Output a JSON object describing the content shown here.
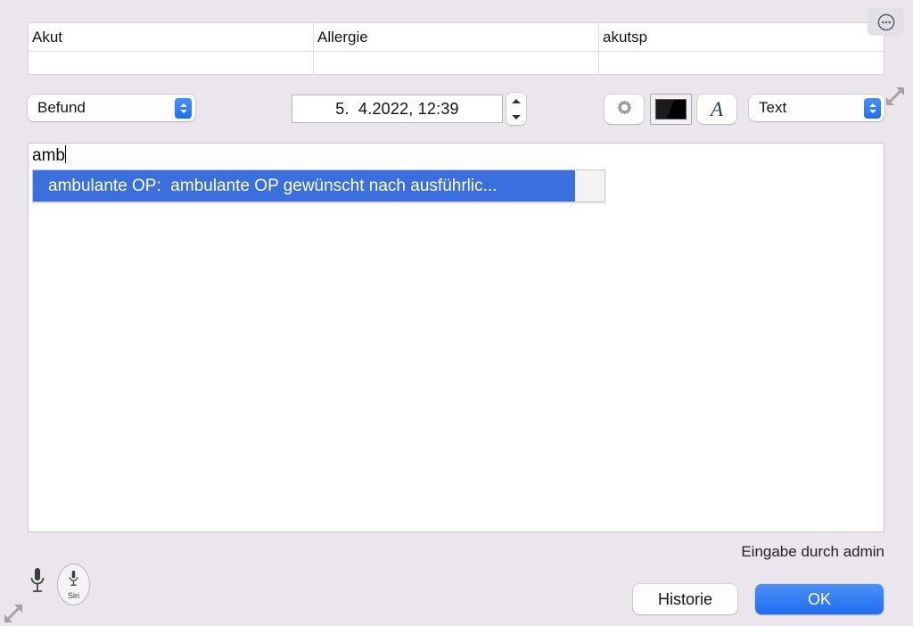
{
  "window": {
    "background_color": "#eae6ec",
    "accent_color": "#1f6cf0",
    "selection_color": "#3a6fdd"
  },
  "attribute_table": {
    "columns": [
      "Akut",
      "Allergie",
      "akutsp"
    ],
    "values": [
      "",
      "",
      ""
    ]
  },
  "more_button": {
    "icon": "ellipsis-circle-icon",
    "label": ""
  },
  "toolbar": {
    "category_popup": {
      "value": "Befund",
      "icon": "up-down-chevron-icon"
    },
    "date_field": {
      "value": "5.  4.2022, 12:39",
      "placeholder": "TT. MM.JJJJ, hh:mm"
    },
    "date_stepper": {
      "icon": "stepper-up-down-icon"
    },
    "gear_button": {
      "icon": "gear-icon",
      "label": ""
    },
    "color_well": {
      "icon": "color-swatch-icon",
      "color": "#000000"
    },
    "font_button": {
      "icon": "italic-a-icon",
      "label": "A"
    },
    "style_popup": {
      "value": "Text",
      "icon": "up-down-chevron-icon"
    },
    "resize_handle_top": {
      "icon": "resize-diagonal-icon"
    }
  },
  "editor": {
    "typed_text": "amb",
    "autocomplete": {
      "items": [
        {
          "text": "ambulante OP:  ambulante OP gewünscht nach ausführlic...",
          "selected": true
        }
      ]
    }
  },
  "footer": {
    "entry_note": "Eingabe durch admin",
    "mic_icon": "microphone-icon",
    "siri_button": {
      "icon": "microphone-icon",
      "label": "Siri"
    },
    "history_button": "Historie",
    "ok_button": "OK",
    "resize_handle_bottom": {
      "icon": "resize-diagonal-icon"
    }
  }
}
